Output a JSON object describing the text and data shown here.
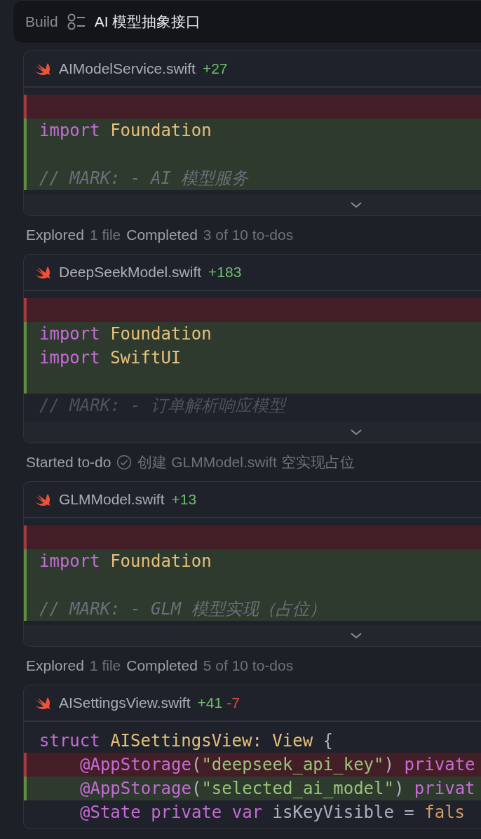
{
  "header": {
    "label": "Build",
    "title": "AI 模型抽象接口"
  },
  "items": [
    {
      "kind": "file",
      "name": "AIModelService.swift",
      "additions": "+27",
      "collapsed": true,
      "lines": [
        {
          "kind": "removed"
        },
        {
          "kind": "added",
          "tokens": [
            {
              "color": "#c56bd6",
              "text": "import"
            },
            {
              "color": "#e5c07b",
              "text": "Foundation"
            }
          ]
        },
        {
          "kind": "added"
        },
        {
          "kind": "added",
          "tokens": [
            {
              "color": "#6b6f78",
              "italic": true,
              "text": "// MARK: - AI 模型服务"
            }
          ]
        }
      ]
    },
    {
      "kind": "status",
      "segments": [
        {
          "kind": "label",
          "text": "Explored"
        },
        {
          "kind": "detail",
          "text": "1 file"
        },
        {
          "kind": "label",
          "text": "Completed"
        },
        {
          "kind": "detail",
          "text": "3 of 10 to-dos"
        }
      ]
    },
    {
      "kind": "file",
      "name": "DeepSeekModel.swift",
      "additions": "+183",
      "collapsed": true,
      "lines": [
        {
          "kind": "removed"
        },
        {
          "kind": "added",
          "tokens": [
            {
              "color": "#c56bd6",
              "text": "import"
            },
            {
              "color": "#e5c07b",
              "text": "Foundation"
            }
          ]
        },
        {
          "kind": "added",
          "tokens": [
            {
              "color": "#c56bd6",
              "text": "import"
            },
            {
              "color": "#e5c07b",
              "text": "SwiftUI"
            }
          ]
        },
        {
          "kind": "added"
        },
        {
          "kind": "context",
          "tokens": [
            {
              "color": "#4e525a",
              "italic": true,
              "text": "// MARK: - 订单解析响应模型"
            }
          ]
        }
      ]
    },
    {
      "kind": "status",
      "segments": [
        {
          "kind": "label",
          "text": "Started to-do"
        },
        {
          "kind": "todo-icon"
        },
        {
          "kind": "detail",
          "text": "创建 GLMModel.swift 空实现占位"
        }
      ]
    },
    {
      "kind": "file",
      "name": "GLMModel.swift",
      "additions": "+13",
      "collapsed": true,
      "lines": [
        {
          "kind": "removed"
        },
        {
          "kind": "added",
          "tokens": [
            {
              "color": "#c56bd6",
              "text": "import"
            },
            {
              "color": "#e5c07b",
              "text": "Foundation"
            }
          ]
        },
        {
          "kind": "added"
        },
        {
          "kind": "added",
          "tokens": [
            {
              "color": "#6b6f78",
              "italic": true,
              "text": "// MARK: - GLM 模型实现（占位）"
            }
          ]
        }
      ]
    },
    {
      "kind": "status",
      "segments": [
        {
          "kind": "label",
          "text": "Explored"
        },
        {
          "kind": "detail",
          "text": "1 file"
        },
        {
          "kind": "label",
          "text": "Completed"
        },
        {
          "kind": "detail",
          "text": "5 of 10 to-dos"
        }
      ]
    },
    {
      "kind": "file",
      "name": "AISettingsView.swift",
      "additions": "+41",
      "deletions": "-7",
      "collapsed": false,
      "lines": [
        {
          "kind": "context",
          "tokens": [
            {
              "color": "#c56bd6",
              "text": "struct"
            },
            {
              "color": "#e5c07b",
              "text": "AISettingsView:"
            },
            {
              "color": "#e5c07b",
              "text": "View"
            },
            {
              "color": "#abb2bf",
              "text": "{"
            }
          ]
        },
        {
          "kind": "removed",
          "indent": true,
          "tokens": [
            {
              "color": "#c56bd6",
              "text": "@AppStorage"
            },
            {
              "color": "#abb2bf",
              "text": "("
            },
            {
              "color": "#98c379",
              "text": "\"deepseek_api_key\""
            },
            {
              "color": "#abb2bf",
              "text": ")"
            },
            {
              "color": "#c56bd6",
              "text": "private"
            }
          ]
        },
        {
          "kind": "added",
          "indent": true,
          "tokens": [
            {
              "color": "#c56bd6",
              "text": "@AppStorage"
            },
            {
              "color": "#abb2bf",
              "text": "("
            },
            {
              "color": "#98c379",
              "text": "\"selected_ai_model\""
            },
            {
              "color": "#abb2bf",
              "text": ")"
            },
            {
              "color": "#c56bd6",
              "text": "privat"
            }
          ]
        },
        {
          "kind": "context",
          "indent": true,
          "tokens": [
            {
              "color": "#c56bd6",
              "text": "@State"
            },
            {
              "color": "#c56bd6",
              "text": "private"
            },
            {
              "color": "#c56bd6",
              "text": "var"
            },
            {
              "color": "#abb2bf",
              "text": "isKeyVisible"
            },
            {
              "color": "#abb2bf",
              "text": "="
            },
            {
              "color": "#d19a66",
              "text": "fals"
            }
          ]
        }
      ]
    }
  ]
}
